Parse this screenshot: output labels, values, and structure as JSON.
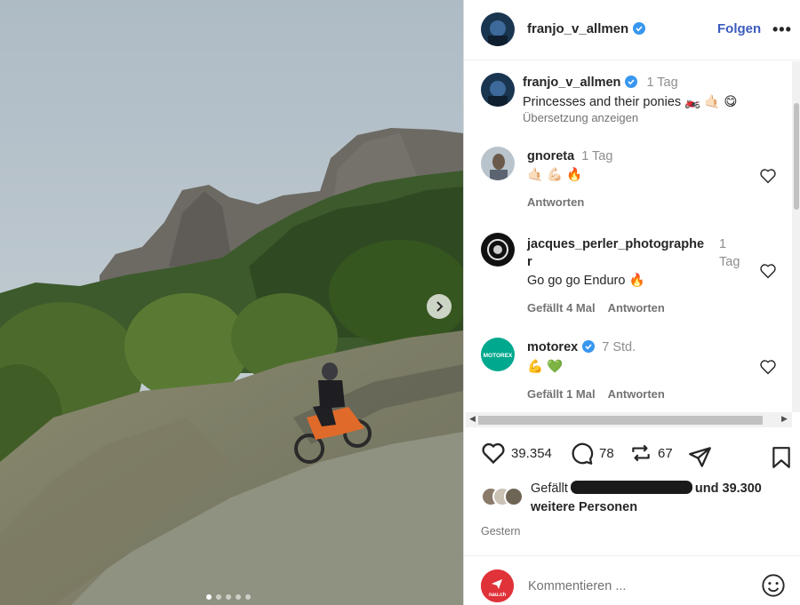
{
  "post": {
    "username": "franjo_v_allmen",
    "follow_label": "Folgen",
    "more_label": "•••",
    "caption": {
      "username": "franjo_v_allmen",
      "time": "1 Tag",
      "text": "Princesses and their ponies 🏍️ 🤙🏻 😋",
      "translate_label": "Übersetzung anzeigen"
    },
    "carousel": {
      "total_slides": 5,
      "active_slide": 1
    }
  },
  "comments": [
    {
      "username": "gnoreta",
      "time": "1 Tag",
      "text": "🤙🏻 💪🏻 🔥",
      "likes": "",
      "reply": "Antworten"
    },
    {
      "username_line1": "jacques_perler_photographe",
      "username_line2": "r",
      "time_line1": "1",
      "time_line2": "Tag",
      "text": "Go go go Enduro 🔥",
      "likes": "Gefällt 4 Mal",
      "reply": "Antworten"
    },
    {
      "username": "motorex",
      "time": "7 Std.",
      "text": "💪 💚",
      "likes": "Gefällt 1 Mal",
      "reply": "Antworten"
    }
  ],
  "actions": {
    "like_count": "39.354",
    "comment_count": "78",
    "repost_count": "67"
  },
  "likes_summary": {
    "prefix": "Gefällt",
    "suffix": "und 39.300",
    "line2": "weitere Personen"
  },
  "date_label": "Gestern",
  "composer": {
    "placeholder": "Kommentieren ...",
    "avatar_text": "nau.ch"
  },
  "colors": {
    "accent": "#3b5cbf",
    "verified": "#3897f0",
    "motorex": "#00a88e",
    "nau": "#e03239"
  }
}
